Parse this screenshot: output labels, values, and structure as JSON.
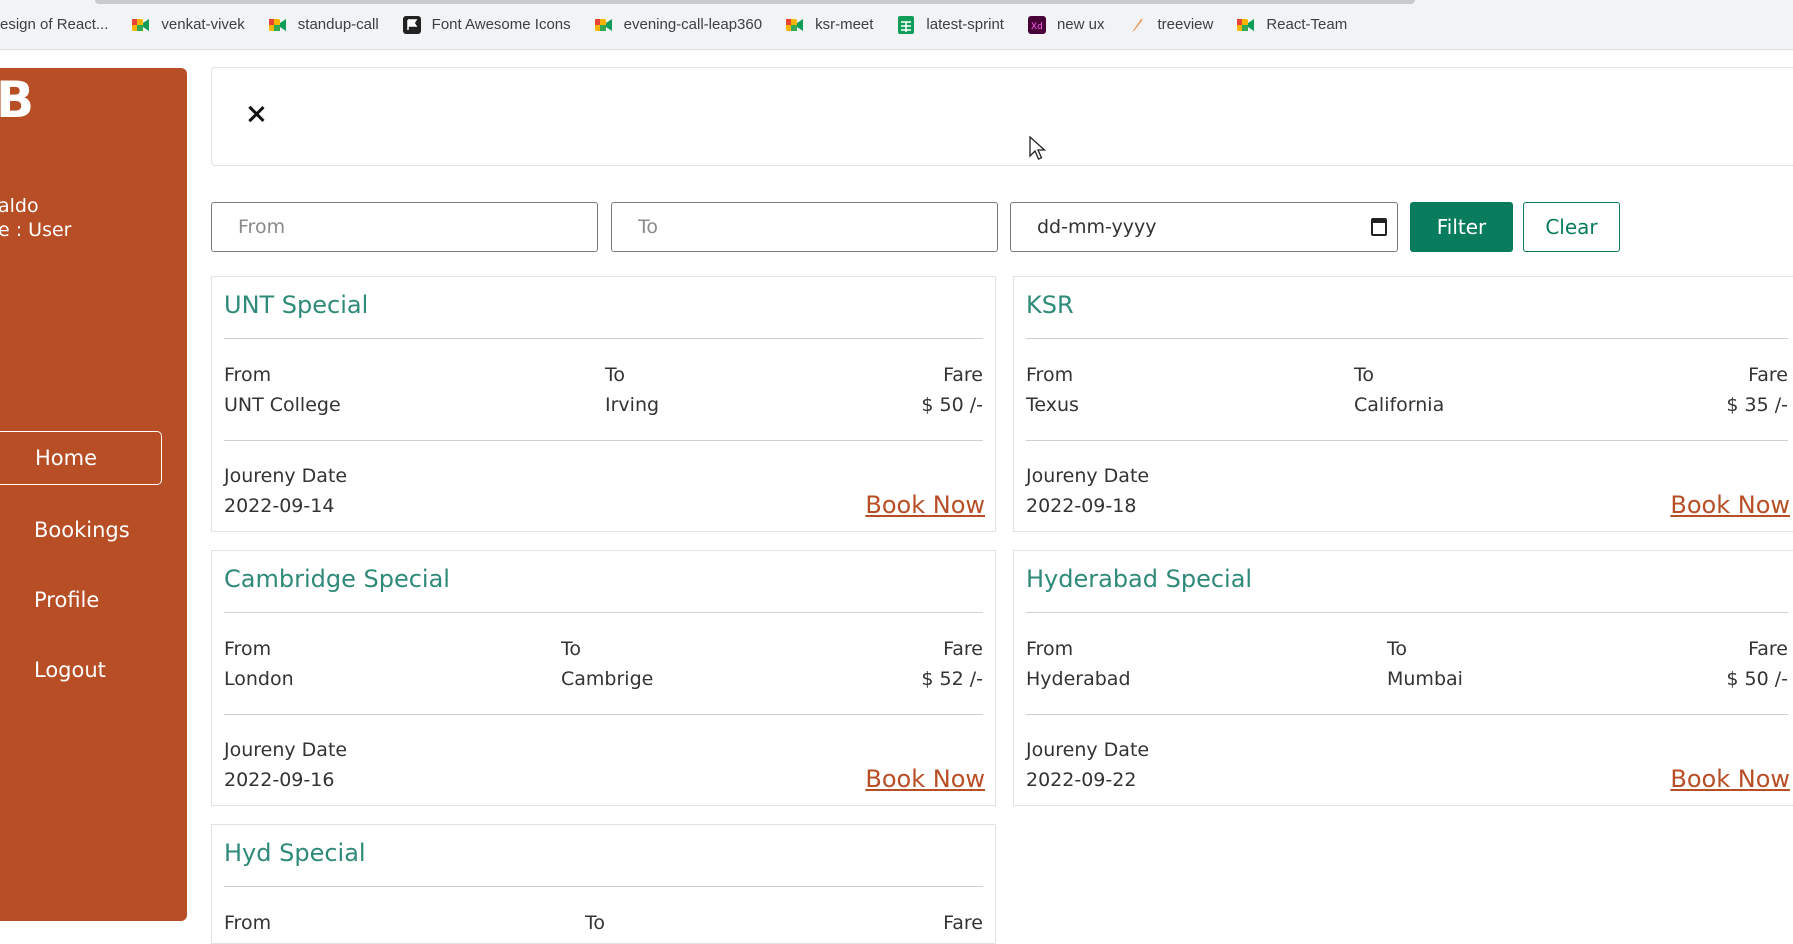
{
  "bookmarks": [
    {
      "label": "esign of React...",
      "icon": "document-icon"
    },
    {
      "label": "venkat-vivek",
      "icon": "meet-icon"
    },
    {
      "label": "standup-call",
      "icon": "meet-icon"
    },
    {
      "label": "Font Awesome Icons",
      "icon": "flag-icon"
    },
    {
      "label": "evening-call-leap360",
      "icon": "meet-icon"
    },
    {
      "label": "ksr-meet",
      "icon": "meet-icon"
    },
    {
      "label": "latest-sprint",
      "icon": "sheets-icon"
    },
    {
      "label": "new ux",
      "icon": "xd-icon"
    },
    {
      "label": "treeview",
      "icon": "feather-icon"
    },
    {
      "label": "React-Team",
      "icon": "meet-icon"
    }
  ],
  "sidebar": {
    "avatar_letter": "B",
    "user_name": "aldo",
    "user_role": "e : User",
    "items": [
      {
        "label": "Home",
        "active": true
      },
      {
        "label": "Bookings"
      },
      {
        "label": "Profile"
      },
      {
        "label": "Logout"
      }
    ]
  },
  "filter": {
    "from_placeholder": "From",
    "to_placeholder": "To",
    "date_placeholder": "dd-mm-yyyy",
    "filter_label": "Filter",
    "clear_label": "Clear"
  },
  "labels": {
    "from": "From",
    "to": "To",
    "fare": "Fare",
    "date": "Joureny Date",
    "book_now": "Book Now"
  },
  "trips": [
    {
      "name": "UNT Special",
      "from": "UNT College",
      "to": "Irving",
      "fare": "$ 50 /-",
      "date": "2022-09-14"
    },
    {
      "name": "KSR",
      "from": "Texus",
      "to": "California",
      "fare": "$ 35 /-",
      "date": "2022-09-18"
    },
    {
      "name": "Cambridge Special",
      "from": "London",
      "to": "Cambrige",
      "fare": "$ 52 /-",
      "date": "2022-09-16"
    },
    {
      "name": "Hyderabad Special",
      "from": "Hyderabad",
      "to": "Mumbai",
      "fare": "$ 50 /-",
      "date": "2022-09-22"
    },
    {
      "name": "Hyd Special",
      "from": "",
      "to": "",
      "fare": "",
      "date": ""
    }
  ],
  "colors": {
    "sidebar_bg": "#b84e26",
    "accent_green": "#087c5c",
    "title_teal": "#2f8a7a",
    "book_link": "#b84e26"
  }
}
